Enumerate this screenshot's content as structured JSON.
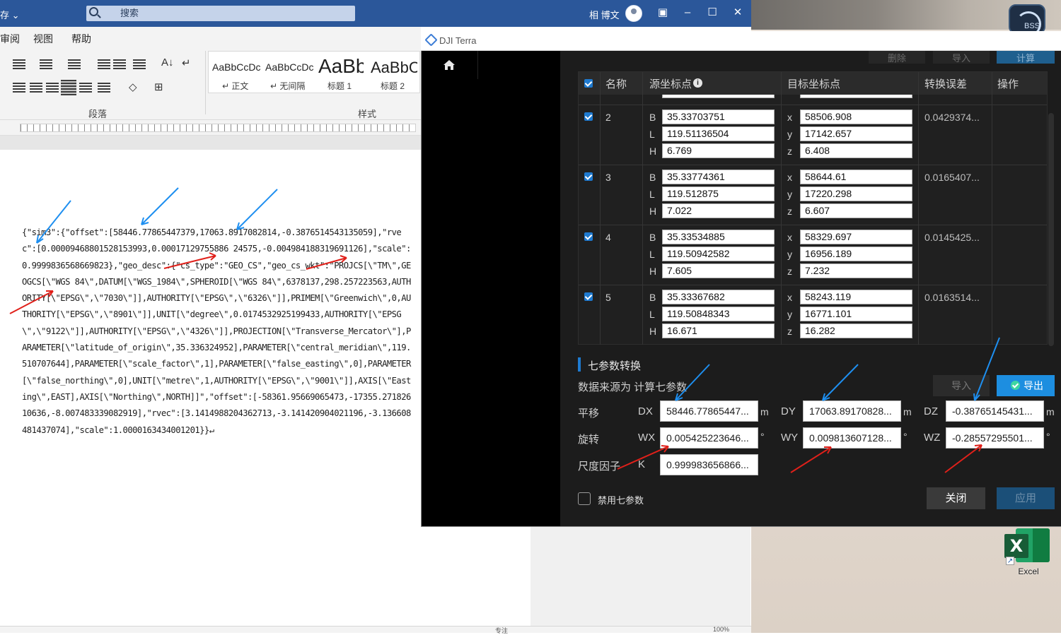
{
  "word": {
    "title_fragment": "存",
    "search_placeholder": "搜索",
    "user_name": "相 博文",
    "menu": [
      "审阅",
      "视图",
      "帮助"
    ],
    "styles": [
      {
        "preview": "AaBbCcDc",
        "name": "正文"
      },
      {
        "preview": "AaBbCcDc",
        "name": "无间隔"
      },
      {
        "preview": "AaBb",
        "name": "标题 1"
      },
      {
        "preview": "AaBbC",
        "name": "标题 2"
      }
    ],
    "group_paragraph": "段落",
    "group_styles": "样式",
    "document_text": "{\"sim3\":{\"offset\":[58446.77865447379,17063.8917082814,-0.3876514543135059],\"rvec\":[0.00009468801528153993,0.00017129755886 24575,-0.004984188319691126],\"scale\":0.9999836568669823},\"geo_desc\":{\"cs_type\":\"GEO_CS\",\"geo_cs_wkt\":\"PROJCS[\\\"TM\\\",GEOGCS[\\\"WGS 84\\\",DATUM[\\\"WGS_1984\\\",SPHEROID[\\\"WGS 84\\\",6378137,298.257223563,AUTHORITY[\\\"EPSG\\\",\\\"7030\\\"]],AUTHORITY[\\\"EPSG\\\",\\\"6326\\\"]],PRIMEM[\\\"Greenwich\\\",0,AUTHORITY[\\\"EPSG\\\",\\\"8901\\\"]],UNIT[\\\"degree\\\",0.0174532925199433,AUTHORITY[\\\"EPSG\\\",\\\"9122\\\"]],AUTHORITY[\\\"EPSG\\\",\\\"4326\\\"]],PROJECTION[\\\"Transverse_Mercator\\\"],PARAMETER[\\\"latitude_of_origin\\\",35.336324952],PARAMETER[\\\"central_meridian\\\",119.510707644],PARAMETER[\\\"scale_factor\\\",1],PARAMETER[\\\"false_easting\\\",0],PARAMETER[\\\"false_northing\\\",0],UNIT[\\\"metre\\\",1,AUTHORITY[\\\"EPSG\\\",\\\"9001\\\"]],AXIS[\\\"Easting\\\",EAST],AXIS[\\\"Northing\\\",NORTH]]\",\"offset\":[-58361.95669065473,-17355.27182610636,-8.007483339082919],\"rvec\":[3.1414988204362713,-3.141420904021196,-3.136608481437074],\"scale\":1.0000163434001201}}↵",
    "status_zoom": "100%",
    "status_focus": "专注"
  },
  "desktop": {
    "excel_label": "Excel",
    "bss_label": "BSS"
  },
  "dji": {
    "window_title": "DJI Terra",
    "top_buttons": [
      "删除",
      "导入",
      "计算"
    ],
    "headers": {
      "name": "名称",
      "source": "源坐标点",
      "target": "目标坐标点",
      "error": "转换误差",
      "action": "操作"
    },
    "rows": [
      {
        "id": "2",
        "B": "35.33703751",
        "L": "119.51136504",
        "H": "6.769",
        "x": "58506.908",
        "y": "17142.657",
        "z": "6.408",
        "error": "0.0429374..."
      },
      {
        "id": "3",
        "B": "35.33774361",
        "L": "119.512875",
        "H": "7.022",
        "x": "58644.61",
        "y": "17220.298",
        "z": "6.607",
        "error": "0.0165407..."
      },
      {
        "id": "4",
        "B": "35.33534885",
        "L": "119.50942582",
        "H": "7.605",
        "x": "58329.697",
        "y": "16956.189",
        "z": "7.232",
        "error": "0.0145425..."
      },
      {
        "id": "5",
        "B": "35.33367682",
        "L": "119.50848343",
        "H": "16.671",
        "x": "58243.119",
        "y": "16771.101",
        "z": "16.282",
        "error": "0.0163514..."
      }
    ],
    "seven_param": {
      "title": "七参数转换",
      "source_label": "数据来源为 计算七参数",
      "import_label": "导入",
      "export_label": "导出",
      "translation_label": "平移",
      "rotation_label": "旋转",
      "scale_label": "尺度因子",
      "DX": "58446.77865447...",
      "DY": "17063.89170828...",
      "DZ": "-0.38765145431...",
      "WX": "0.005425223646...",
      "WY": "0.009813607128...",
      "WZ": "-0.28557295501...",
      "K": "0.999983656866...",
      "unit_m": "m",
      "unit_deg": "°"
    },
    "disable_label": "禁用七参数",
    "close_label": "关闭",
    "apply_label": "应用"
  },
  "colors": {
    "word_blue": "#2b579a",
    "dji_bg": "#1c1c1c",
    "accent_blue": "#1d8ee0",
    "annotation_blue": "#1e8ff0",
    "annotation_red": "#e0201a"
  }
}
